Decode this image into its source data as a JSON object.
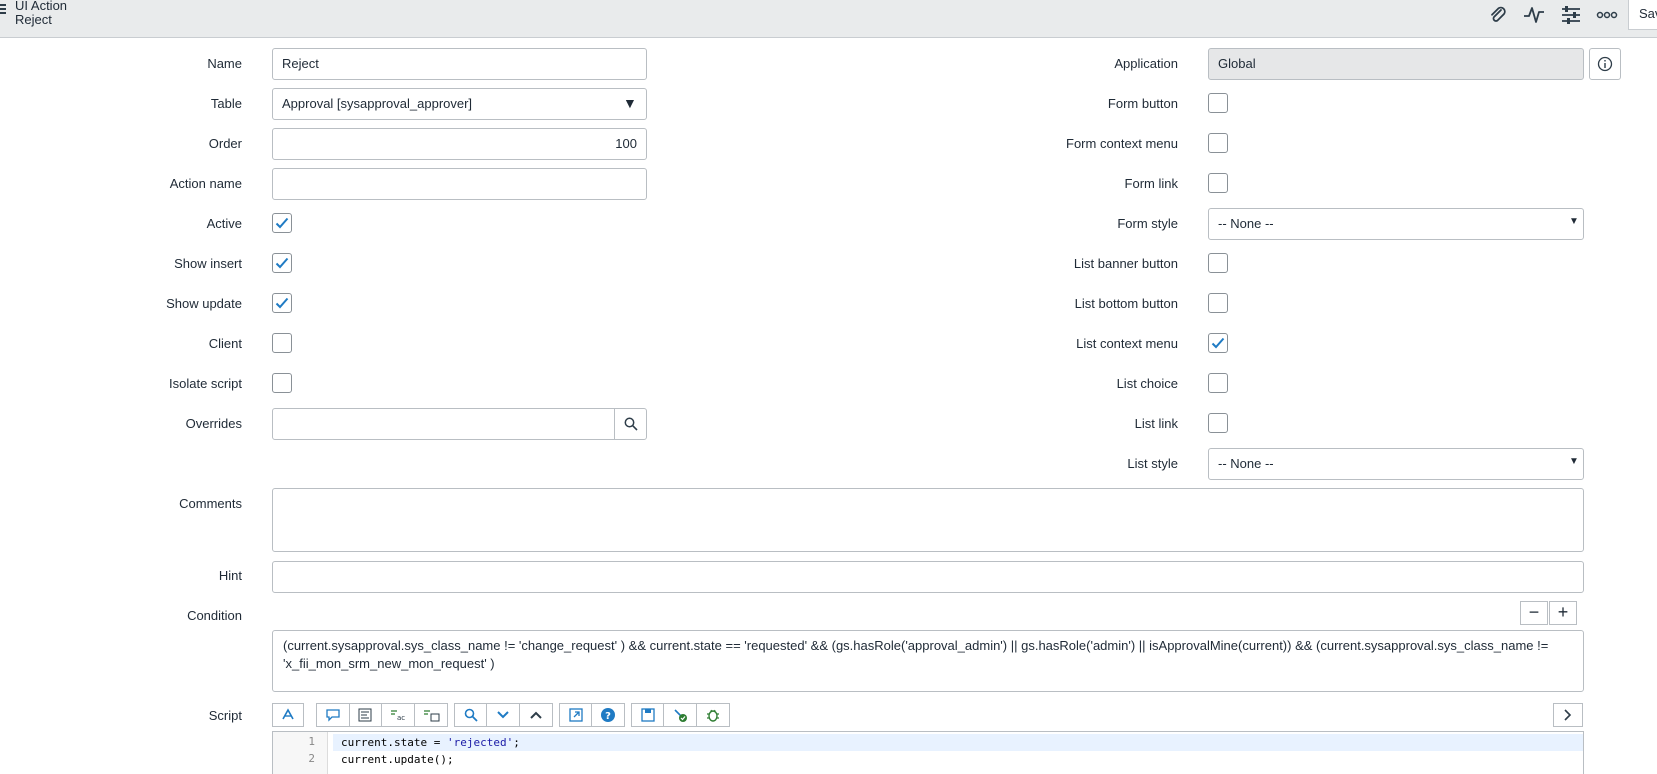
{
  "header": {
    "title": "UI Action",
    "subtitle": "Reject",
    "save_label": "Sav",
    "icons": [
      "paperclip-icon",
      "activity-icon",
      "sliders-icon",
      "more-icon"
    ]
  },
  "fields_left": {
    "name": {
      "label": "Name",
      "value": "Reject"
    },
    "table": {
      "label": "Table",
      "value": "Approval [sysapproval_approver]"
    },
    "order": {
      "label": "Order",
      "value": "100"
    },
    "action_name": {
      "label": "Action name",
      "value": ""
    },
    "active": {
      "label": "Active",
      "checked": true
    },
    "show_insert": {
      "label": "Show insert",
      "checked": true
    },
    "show_update": {
      "label": "Show update",
      "checked": true
    },
    "client": {
      "label": "Client",
      "checked": false
    },
    "isolate_script": {
      "label": "Isolate script",
      "checked": false
    },
    "overrides": {
      "label": "Overrides",
      "value": ""
    }
  },
  "fields_right": {
    "application": {
      "label": "Application",
      "value": "Global"
    },
    "form_button": {
      "label": "Form button",
      "checked": false
    },
    "form_context_menu": {
      "label": "Form context menu",
      "checked": false
    },
    "form_link": {
      "label": "Form link",
      "checked": false
    },
    "form_style": {
      "label": "Form style",
      "value": "-- None --"
    },
    "list_banner_button": {
      "label": "List banner button",
      "checked": false
    },
    "list_bottom_button": {
      "label": "List bottom button",
      "checked": false
    },
    "list_context_menu": {
      "label": "List context menu",
      "checked": true
    },
    "list_choice": {
      "label": "List choice",
      "checked": false
    },
    "list_link": {
      "label": "List link",
      "checked": false
    },
    "list_style": {
      "label": "List style",
      "value": "-- None --"
    }
  },
  "comments": {
    "label": "Comments",
    "value": ""
  },
  "hint": {
    "label": "Hint",
    "value": ""
  },
  "condition": {
    "label": "Condition",
    "line1": "(current.sysapproval.sys_class_name != 'change_request' ) && current.state == 'requested' && (gs.hasRole('approval_admin') || gs.hasRole('admin') || isApprovalMine(current)) && (current.sysapproval.sys_class_name !=",
    "line2": "'x_fii_mon_srm_new_mon_request' )",
    "minus": "−",
    "plus": "+"
  },
  "script": {
    "label": "Script",
    "lines": [
      {
        "num": "1",
        "pre": "current.state = ",
        "str": "'rejected'",
        "post": ";"
      },
      {
        "num": "2",
        "pre": "current.update();",
        "str": "",
        "post": ""
      }
    ],
    "toolbar": [
      "format-icon",
      "comment-icon",
      "outline-icon",
      "replace-icon",
      "replace-all-icon",
      "search-icon",
      "fold-down-icon",
      "fold-up-icon",
      "fullscreen-icon",
      "help-icon",
      "save-icon",
      "syntax-check-icon",
      "debug-icon",
      "expand-icon"
    ]
  },
  "colors": {
    "accent": "#1f7bc4",
    "header_bg": "#e9ebec",
    "readonly_bg": "#e6e7e8"
  }
}
